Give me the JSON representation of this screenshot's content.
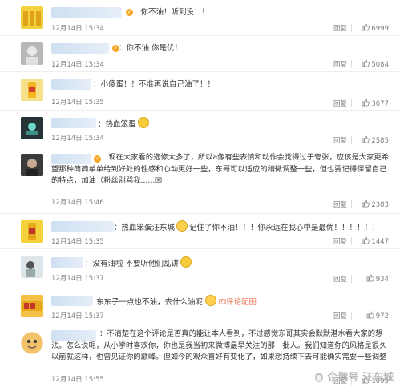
{
  "comments": [
    {
      "text": "：你不油！听到没！！",
      "date": "12月14日 15:34",
      "reply": "回复",
      "likes": "6999"
    },
    {
      "text": "：你不油 你是优！",
      "date": "12月14日 15:34",
      "reply": "回复",
      "likes": "5084"
    },
    {
      "text": "：小傻蛋！！不准再说自己油了！！",
      "date": "12月14日 15:35",
      "reply": "回复",
      "likes": "3677"
    },
    {
      "text": "：热血笨蛋",
      "date": "12月14日 15:34",
      "reply": "回复",
      "likes": "2585"
    },
    {
      "text": "：现在大家看的选修太多了，所以a像有些表情和动作会觉得过于夸张，应该是大家更希望那种简简单单给到好处的性感和心动更好一些，东哥可以适应的稍微调整一些，但也要记得保留自己的特点，加油（粉丝别骂我......",
      "date": "12月14日 15:46",
      "reply": "回复",
      "likes": "2383"
    },
    {
      "text": "：热血笨蛋汪东城",
      "text2": "记住了你不油！！！你永远在我心中是最优！！！！！！",
      "date": "12月14日 15:35",
      "reply": "回复",
      "likes": "1447"
    },
    {
      "text": "：没有油啦  不要听他们乱讲",
      "date": "12月14日 15:37",
      "reply": "回复",
      "likes": "934"
    },
    {
      "text": "东东子一点也不油，去什么油呢",
      "link": "评论配图",
      "date": "12月14日 15:37",
      "reply": "回复",
      "likes": "972"
    },
    {
      "text": "：不清楚在这个评论是否真的能让本人看到，不过感觉东哥其实会默默潜水看大家的想法。怎么说呢，从小学时喜欢你，你也是我当初来微博最早关注的那一批人。我们知道你的风格是很久以前就这样，也曾见证你的巅峰。但如今的观众喜好有变化了，如果想持续下去可能确实需要一些调整",
      "date": "12月14日 15:55",
      "reply": "回复",
      "likes": "1095"
    }
  ],
  "watermark": "企鹅号 汪东城"
}
